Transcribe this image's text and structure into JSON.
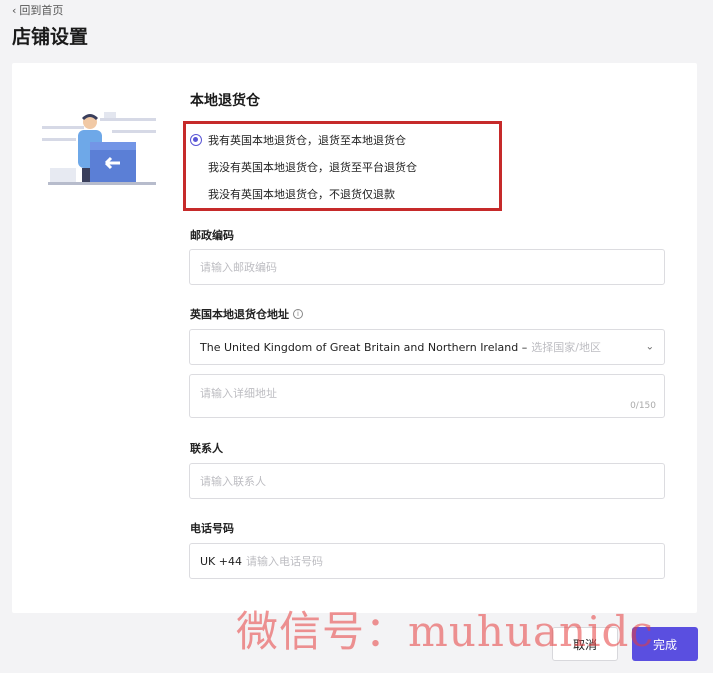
{
  "header": {
    "back_label": "回到首页",
    "title": "店铺设置"
  },
  "section": {
    "title": "本地退货仓",
    "options": [
      {
        "label": "我有英国本地退货仓，退货至本地退货仓",
        "selected": true
      },
      {
        "label": "我没有英国本地退货仓，退货至平台退货仓",
        "selected": false
      },
      {
        "label": "我没有英国本地退货仓，不退货仅退款",
        "selected": false
      }
    ]
  },
  "postal": {
    "label": "邮政编码",
    "placeholder": "请输入邮政编码"
  },
  "address": {
    "label": "英国本地退货仓地址",
    "country_value": "The United Kingdom of Great Britain and Northern Ireland –",
    "region_placeholder": "选择国家/地区",
    "detail_placeholder": "请输入详细地址",
    "counter": "0/150"
  },
  "contact": {
    "label": "联系人",
    "placeholder": "请输入联系人"
  },
  "phone": {
    "label": "电话号码",
    "prefix": "UK +44",
    "placeholder": "请输入电话号码"
  },
  "footer": {
    "cancel_label": "取消",
    "done_label": "完成"
  },
  "watermark": "微信号：muhuanidc",
  "colors": {
    "accent": "#5a4fe0",
    "highlight_box": "#c62a2a"
  }
}
